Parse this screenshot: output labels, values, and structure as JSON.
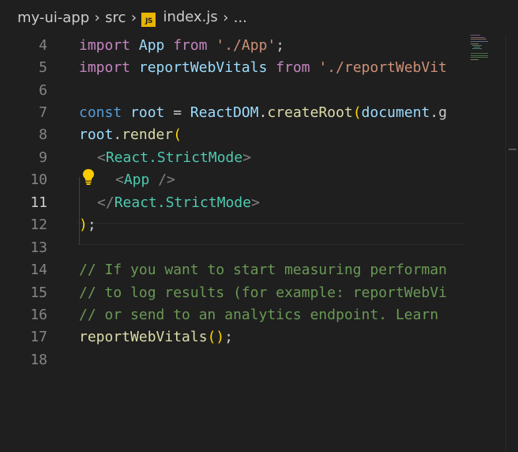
{
  "breadcrumb": {
    "folder1": "my-ui-app",
    "folder2": "src",
    "file_badge": "JS",
    "file": "index.js",
    "more": "..."
  },
  "editor": {
    "active_line": "11",
    "lines": [
      {
        "num": "4",
        "tokens": [
          "import",
          " App ",
          "from",
          " ",
          "'./App'",
          ";"
        ]
      },
      {
        "num": "5",
        "tokens": [
          "import",
          " reportWebVitals ",
          "from",
          " ",
          "'./reportWebVit"
        ]
      },
      {
        "num": "6",
        "tokens": []
      },
      {
        "num": "7",
        "tokens": [
          "const",
          " ",
          "root",
          " = ",
          "ReactDOM",
          ".",
          "createRoot",
          "(",
          "document",
          ".g"
        ]
      },
      {
        "num": "8",
        "tokens": [
          "root",
          ".",
          "render",
          "("
        ]
      },
      {
        "num": "9",
        "tokens": [
          "<",
          "React.StrictMode",
          ">"
        ]
      },
      {
        "num": "10",
        "tokens": [
          "<",
          "App",
          " />"
        ]
      },
      {
        "num": "11",
        "tokens": [
          "</",
          "React.StrictMode",
          ">"
        ]
      },
      {
        "num": "12",
        "tokens": [
          ")",
          ";"
        ]
      },
      {
        "num": "13",
        "tokens": []
      },
      {
        "num": "14",
        "tokens": [
          "// If you want to start measuring performan"
        ]
      },
      {
        "num": "15",
        "tokens": [
          "// to log results (for example: reportWebVi"
        ]
      },
      {
        "num": "16",
        "tokens": [
          "// or send to an analytics endpoint. Learn"
        ]
      },
      {
        "num": "17",
        "tokens": [
          "reportWebVitals",
          "(",
          ")",
          ";"
        ]
      },
      {
        "num": "18",
        "tokens": []
      }
    ]
  },
  "colors": {
    "background": "#1f1f1f",
    "keyword": "#c586c0",
    "string": "#ce9178",
    "function": "#dcdcaa",
    "comment": "#6a9955",
    "tag": "#4ec9b0",
    "bulb": "#ffcc00"
  },
  "icons": {
    "breadcrumb_separator": "chevron-right-icon",
    "file_type": "javascript-file-icon",
    "quick_fix": "lightbulb-icon"
  }
}
